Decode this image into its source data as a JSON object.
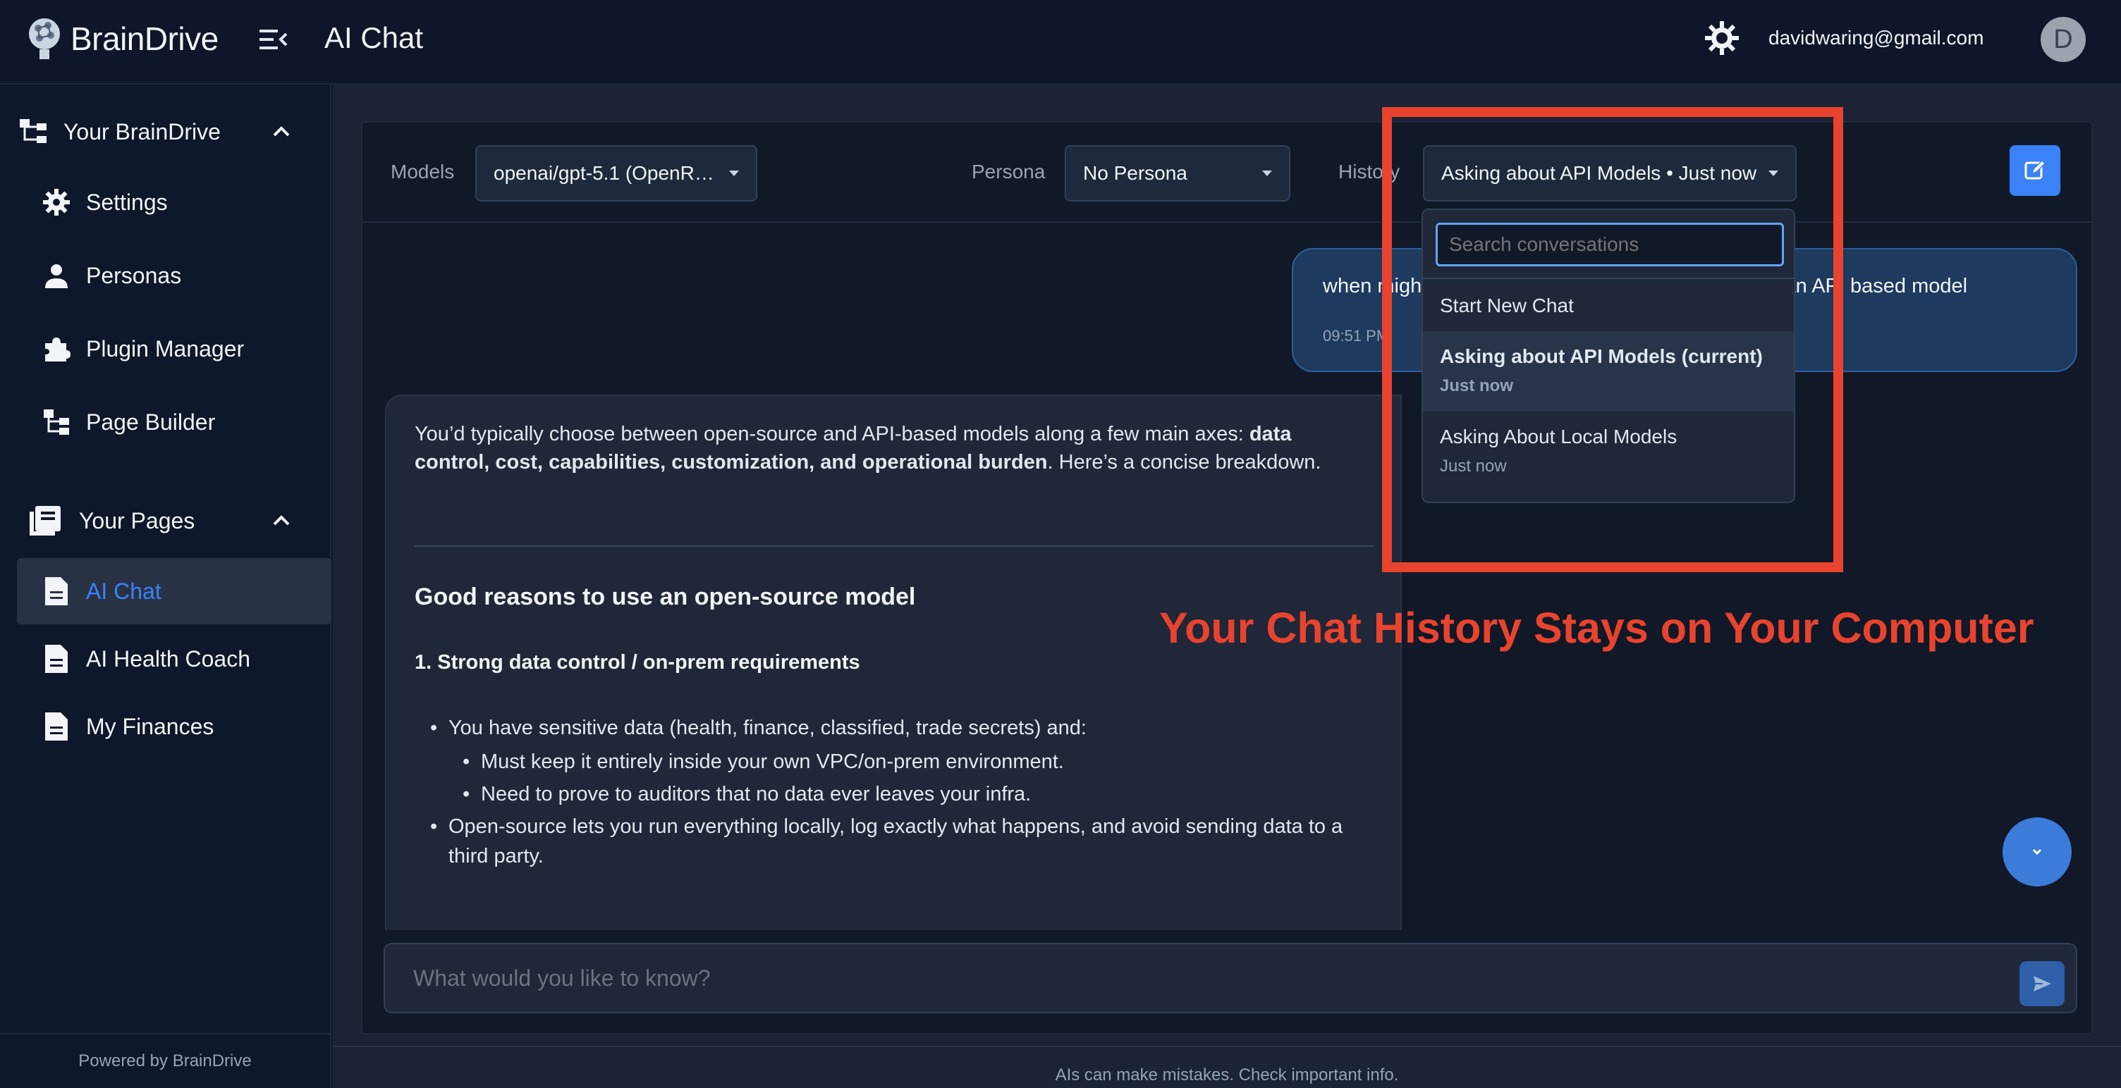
{
  "app": {
    "brand": "BrainDrive",
    "page_title": "AI Chat",
    "user_email": "davidwaring@gmail.com",
    "avatar_initial": "D"
  },
  "sidebar": {
    "section_brain": "Your BrainDrive",
    "section_pages": "Your Pages",
    "brain_items": [
      {
        "label": "Settings",
        "icon": "gear-icon"
      },
      {
        "label": "Personas",
        "icon": "person-icon"
      },
      {
        "label": "Plugin Manager",
        "icon": "puzzle-icon"
      },
      {
        "label": "Page Builder",
        "icon": "sitemap-icon"
      }
    ],
    "page_items": [
      {
        "label": "AI Chat",
        "icon": "document-icon",
        "active": true
      },
      {
        "label": "AI Health Coach",
        "icon": "document-icon"
      },
      {
        "label": "My Finances",
        "icon": "document-icon"
      }
    ],
    "footer": "Powered by BrainDrive"
  },
  "toolbar": {
    "models_label": "Models",
    "models_value": "openai/gpt-5.1 (OpenR…",
    "persona_label": "Persona",
    "persona_value": "No Persona",
    "history_label": "History",
    "history_value": "Asking about API Models • Just now"
  },
  "history_dropdown": {
    "search_placeholder": "Search conversations",
    "start_new": "Start New Chat",
    "items": [
      {
        "title": "Asking about API Models (current)",
        "time": "Just now"
      },
      {
        "title": "Asking About Local Models",
        "time": "Just now"
      }
    ]
  },
  "messages": {
    "user_text": "when might you choose an open-source model vs. an API based model",
    "user_time": "09:51 PM",
    "ai_intro_1": "You’d typically choose between open-source and API-based models along a few main axes: ",
    "ai_intro_bold": "data control, cost, capabilities, customization, and operational burden",
    "ai_intro_2": ". Here’s a concise breakdown.",
    "ai_heading": "Good reasons to use an open-source model",
    "ai_subheading": "1. Strong data control / on-prem requirements",
    "bullet_1": "You have sensitive data (health, finance, classified, trade secrets) and:",
    "sub_bullet_1": "Must keep it entirely inside your own VPC/on-prem environment.",
    "sub_bullet_2": "Need to prove to auditors that no data ever leaves your infra.",
    "bullet_2": "Open-source lets you run everything locally, log exactly what happens, and avoid sending data to a third party."
  },
  "annotation": "Your Chat History Stays on Your Computer",
  "composer": {
    "placeholder": "What would you like to know?"
  },
  "disclaimer": "AIs can make mistakes. Check important info.",
  "colors": {
    "accent": "#3b82f6",
    "annotation_red": "#e8432e",
    "background": "#0f172a"
  }
}
